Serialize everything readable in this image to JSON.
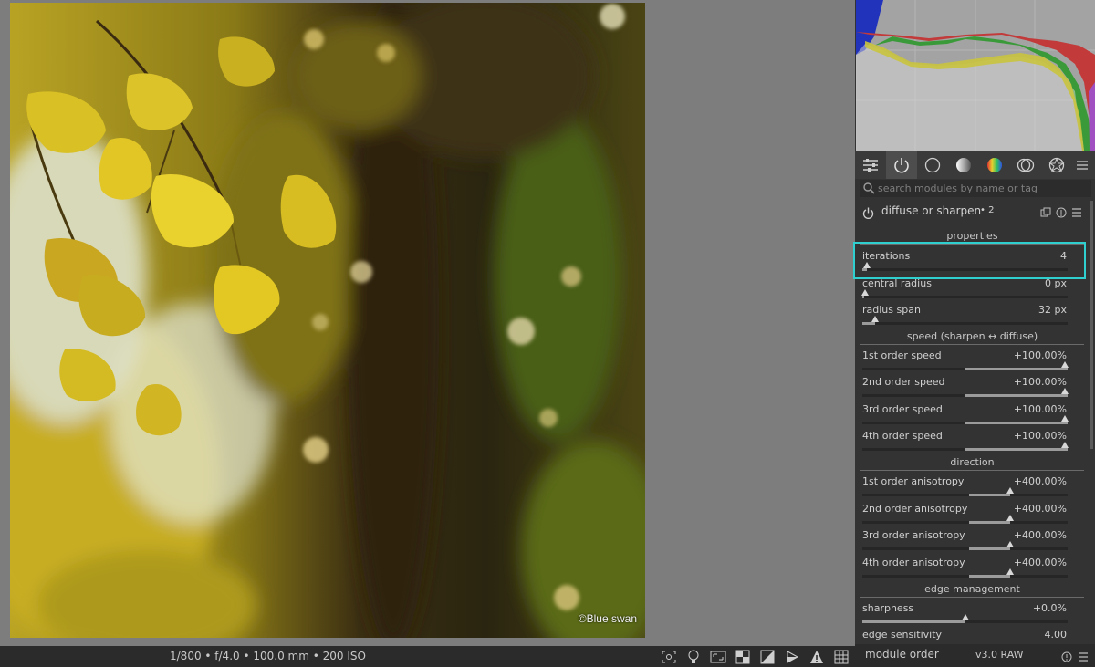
{
  "photo": {
    "watermark": "©Blue swan"
  },
  "bottom_bar": {
    "exif": "1/800 • f/4.0 • 100.0 mm • 200 ISO",
    "icons": [
      "focus-peaking-icon",
      "color-assessment-icon",
      "softproof-icon",
      "overexposed-icon",
      "rawoverexposed-icon",
      "gamut-check-icon",
      "warning-icon",
      "guides-icon"
    ]
  },
  "tabs": [
    "quick-access-icon",
    "active-modules-icon",
    "base-icon",
    "tone-icon",
    "color-icon",
    "correct-icon",
    "effect-icon",
    "menu-icon"
  ],
  "search": {
    "placeholder": "search modules by name or tag"
  },
  "module": {
    "title": "diffuse or sharpen",
    "instance": "• 2"
  },
  "sections": {
    "properties": "properties",
    "speed": "speed (sharpen ↔ diffuse)",
    "direction": "direction",
    "edge": "edge management"
  },
  "sliders": {
    "iterations": {
      "label": "iterations",
      "value": "4",
      "fraction": 0.02
    },
    "central_radius": {
      "label": "central radius",
      "value": "0 px",
      "fraction": 0.0
    },
    "radius_span": {
      "label": "radius span",
      "value": "32 px",
      "fraction": 0.06
    },
    "speed1": {
      "label": "1st order speed",
      "value": "+100.00%",
      "fraction": 1.0
    },
    "speed2": {
      "label": "2nd order speed",
      "value": "+100.00%",
      "fraction": 1.0
    },
    "speed3": {
      "label": "3rd order speed",
      "value": "+100.00%",
      "fraction": 1.0
    },
    "speed4": {
      "label": "4th order speed",
      "value": "+100.00%",
      "fraction": 1.0
    },
    "aniso1": {
      "label": "1st order anisotropy",
      "value": "+400.00%",
      "fraction": 0.72
    },
    "aniso2": {
      "label": "2nd order anisotropy",
      "value": "+400.00%",
      "fraction": 0.72
    },
    "aniso3": {
      "label": "3rd order anisotropy",
      "value": "+400.00%",
      "fraction": 0.72
    },
    "aniso4": {
      "label": "4th order anisotropy",
      "value": "+400.00%",
      "fraction": 0.72
    },
    "sharpness": {
      "label": "sharpness",
      "value": "+0.0%",
      "fraction": 0.5
    },
    "edge_sensitivity": {
      "label": "edge sensitivity",
      "value": "4.00",
      "fraction": 0.3
    }
  },
  "footer": {
    "module_order": "module order",
    "version": "v3.0 RAW"
  },
  "colors": {
    "highlight": "#2fcfcf",
    "panel": "#333333",
    "histogram_bg": "#a3a3a3"
  }
}
